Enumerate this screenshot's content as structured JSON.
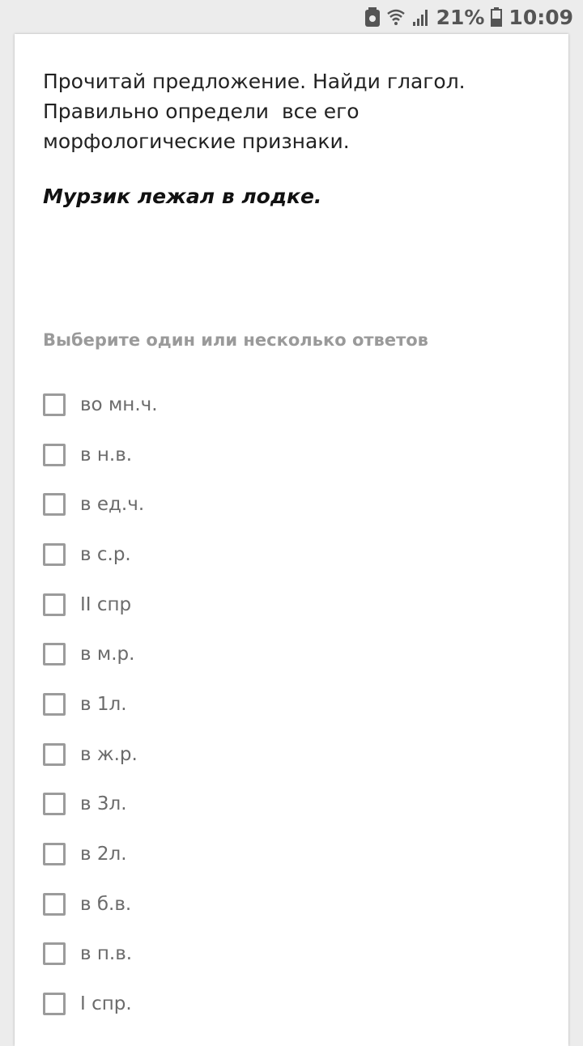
{
  "status_bar": {
    "battery_percent": "21%",
    "time": "10:09",
    "icons": [
      "notification-battery-icon",
      "wifi-icon",
      "signal-icon",
      "battery-icon"
    ]
  },
  "question": {
    "line1": "Прочитай предложение. Найди глагол.",
    "line2": "Правильно определи  все его",
    "line3": "морфологические признаки.",
    "sentence": "Мурзик лежал в лодке."
  },
  "instruction": "Выберите один или несколько ответов",
  "options": [
    {
      "label": "во мн.ч.",
      "checked": false
    },
    {
      "label": "в н.в.",
      "checked": false
    },
    {
      "label": "в ед.ч.",
      "checked": false
    },
    {
      "label": "в с.р.",
      "checked": false
    },
    {
      "label": "II спр",
      "checked": false
    },
    {
      "label": "в м.р.",
      "checked": false
    },
    {
      "label": "в 1л.",
      "checked": false
    },
    {
      "label": "в ж.р.",
      "checked": false
    },
    {
      "label": "в 3л.",
      "checked": false
    },
    {
      "label": "в 2л.",
      "checked": false
    },
    {
      "label": "в б.в.",
      "checked": false
    },
    {
      "label": "в п.в.",
      "checked": false
    },
    {
      "label": "I спр.",
      "checked": false
    }
  ],
  "colors": {
    "background": "#ececec",
    "card": "#ffffff",
    "text": "#222222",
    "instruction": "#9a9a9a",
    "option_text": "#6b6b6b",
    "checkbox_border": "#9b9b9b"
  }
}
